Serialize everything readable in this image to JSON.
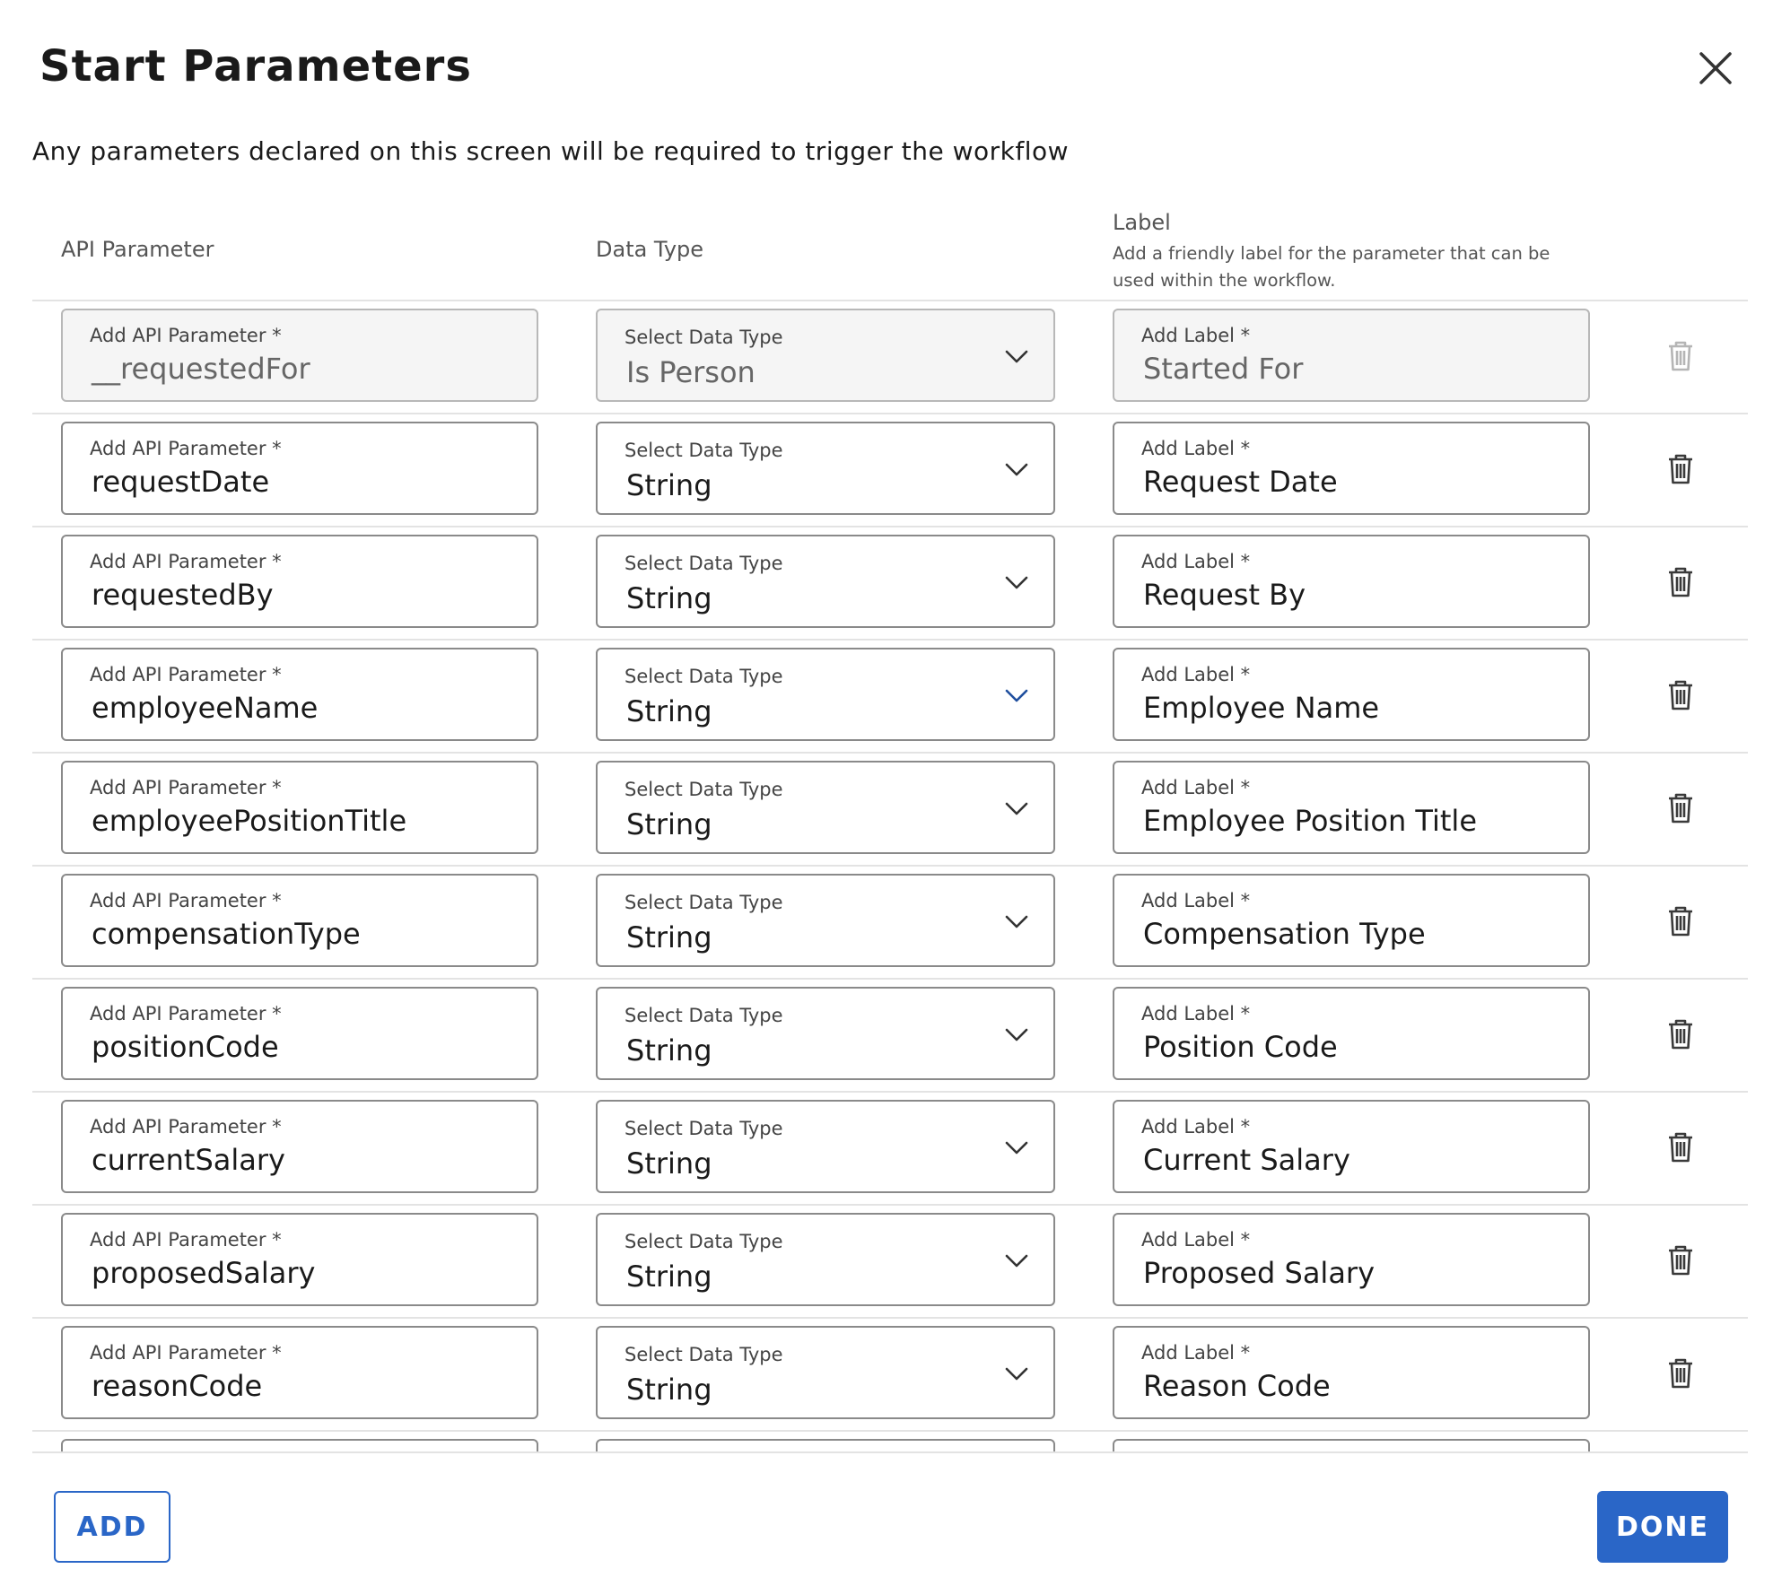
{
  "dialog": {
    "title": "Start Parameters",
    "subtitle": "Any parameters declared on this screen will be required to trigger the workflow"
  },
  "columns": {
    "api": "API Parameter",
    "type": "Data Type",
    "label": "Label",
    "label_help": "Add a friendly label for the parameter that can be used within the workflow."
  },
  "field_labels": {
    "api": "Add API Parameter *",
    "type": "Select Data Type",
    "label": "Add Label *"
  },
  "rows": [
    {
      "api": "__requestedFor",
      "type": "Is Person",
      "label": "Started For",
      "disabled": true
    },
    {
      "api": "requestDate",
      "type": "String",
      "label": "Request Date",
      "disabled": false
    },
    {
      "api": "requestedBy",
      "type": "String",
      "label": "Request By",
      "disabled": false
    },
    {
      "api": "employeeName",
      "type": "String",
      "label": "Employee Name",
      "disabled": false,
      "focused": true
    },
    {
      "api": "employeePositionTitle",
      "type": "String",
      "label": "Employee Position Title",
      "disabled": false
    },
    {
      "api": "compensationType",
      "type": "String",
      "label": "Compensation Type",
      "disabled": false
    },
    {
      "api": "positionCode",
      "type": "String",
      "label": "Position Code",
      "disabled": false
    },
    {
      "api": "currentSalary",
      "type": "String",
      "label": "Current Salary",
      "disabled": false
    },
    {
      "api": "proposedSalary",
      "type": "String",
      "label": "Proposed Salary",
      "disabled": false
    },
    {
      "api": "reasonCode",
      "type": "String",
      "label": "Reason Code",
      "disabled": false
    },
    {
      "api": "",
      "type": "",
      "label": "",
      "disabled": false
    }
  ],
  "footer": {
    "add_label": "ADD",
    "done_label": "DONE"
  },
  "colors": {
    "accent": "#2a66c7",
    "focused_chevron": "#1f4f9e",
    "border": "#8a8a8a",
    "divider": "#e3e3e3"
  }
}
